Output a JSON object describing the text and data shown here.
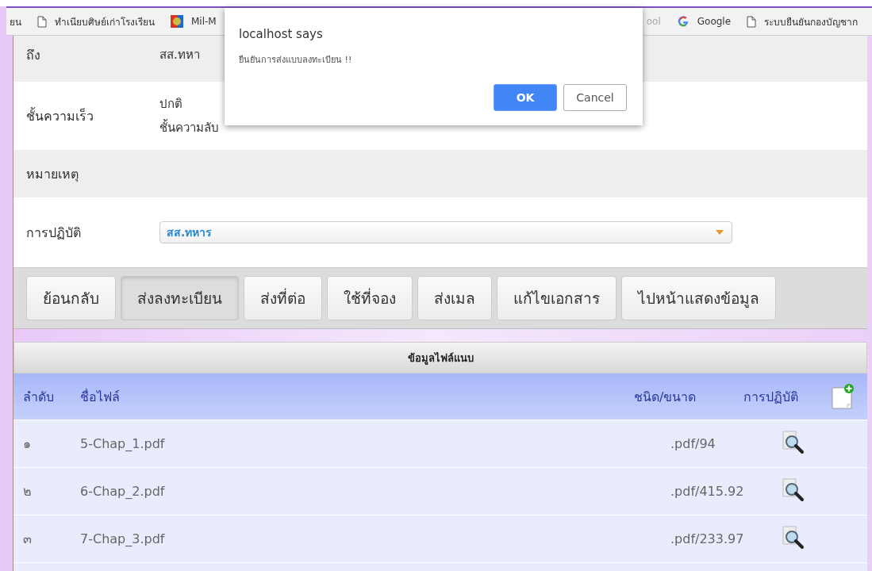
{
  "bookmarks": [
    {
      "label": "ยน",
      "kind": "plain"
    },
    {
      "label": "ทำเนียบศิษย์เก่าโรงเรียน",
      "kind": "page"
    },
    {
      "label": "Mil-M",
      "kind": "emblem"
    },
    {
      "label": "ool",
      "kind": "plain"
    },
    {
      "label": "Google",
      "kind": "google"
    },
    {
      "label": "ระบบยืนยันกองบัญชาก",
      "kind": "page"
    }
  ],
  "form": [
    {
      "label": "ถึง",
      "values": [
        "สส.ทหา"
      ],
      "kind": "text"
    },
    {
      "label": "ชั้นความเร็ว",
      "values": [
        "ปกติ",
        "ชั้นความลับ"
      ],
      "kind": "text"
    },
    {
      "label": "หมายเหตุ",
      "kind": "text"
    },
    {
      "label": "การปฏิบัติ",
      "values": [
        "สส.ทหาร"
      ],
      "kind": "select"
    }
  ],
  "buttons": [
    {
      "label": "ย้อนกลับ",
      "selected": false
    },
    {
      "label": "ส่งลงทะเบียน",
      "selected": true
    },
    {
      "label": "ส่งที่ต่อ",
      "selected": false
    },
    {
      "label": "ใช้ที่จอง",
      "selected": false
    },
    {
      "label": "ส่งเมล",
      "selected": false
    },
    {
      "label": "แก้ไขเอกสาร",
      "selected": false
    },
    {
      "label": "ไปหน้าแสดงข้อมูล",
      "selected": false
    }
  ],
  "attachments": {
    "title": "ข้อมูลไฟล์แนบ",
    "columns": [
      "ลำดับ",
      "ชื่อไฟล์",
      "ชนิด/ขนาด",
      "การปฏิบัติ"
    ],
    "rows": [
      {
        "no": "๑",
        "name": "5-Chap_1.pdf",
        "type_size": ".pdf/94"
      },
      {
        "no": "๒",
        "name": "6-Chap_2.pdf",
        "type_size": ".pdf/415.92"
      },
      {
        "no": "๓",
        "name": "7-Chap_3.pdf",
        "type_size": ".pdf/233.97"
      }
    ]
  },
  "dialog": {
    "title": "localhost says",
    "message": "ยืนยันการส่งแบบลงทะเบียน !!",
    "buttons": [
      {
        "label": "OK",
        "kind": "primary"
      },
      {
        "label": "Cancel",
        "kind": "secondary"
      }
    ]
  }
}
